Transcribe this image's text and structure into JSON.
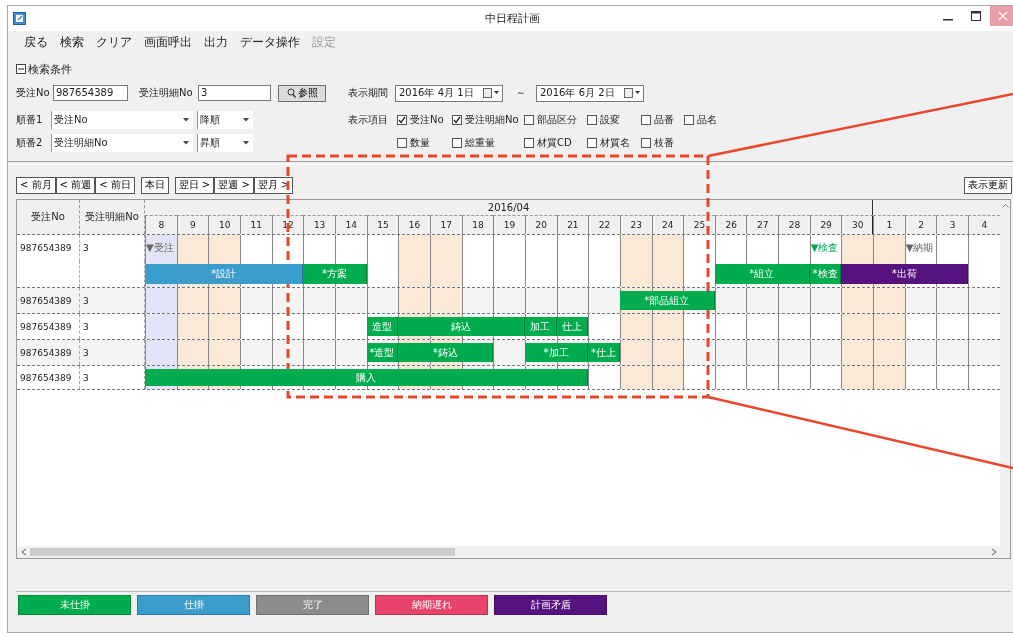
{
  "window": {
    "title": "中日程計画"
  },
  "menu": [
    {
      "label": "戻る",
      "disabled": false
    },
    {
      "label": "検索",
      "disabled": false
    },
    {
      "label": "クリア",
      "disabled": false
    },
    {
      "label": "画面呼出",
      "disabled": false
    },
    {
      "label": "出力",
      "disabled": false
    },
    {
      "label": "データ操作",
      "disabled": false
    },
    {
      "label": "設定",
      "disabled": true
    }
  ],
  "search": {
    "title": "検索条件",
    "expanded": true,
    "order_no": {
      "label": "受注No",
      "value": "987654389"
    },
    "detail_no": {
      "label": "受注明細No",
      "value": "3"
    },
    "lookup_button": "参照",
    "period": {
      "label": "表示期間",
      "from": "2016年 4月 1日",
      "separator": "～",
      "to": "2016年 6月 2日"
    },
    "sort": [
      {
        "label": "順番1",
        "field": "受注No",
        "order": "降順"
      },
      {
        "label": "順番2",
        "field": "受注明細No",
        "order": "昇順"
      }
    ],
    "display_items_label": "表示項目",
    "display_items": [
      {
        "label": "受注No",
        "checked": true
      },
      {
        "label": "受注明細No",
        "checked": true
      },
      {
        "label": "部品区分",
        "checked": false
      },
      {
        "label": "設変",
        "checked": false
      },
      {
        "label": "品番",
        "checked": false
      },
      {
        "label": "品名",
        "checked": false
      },
      {
        "label": "数量",
        "checked": false
      },
      {
        "label": "総重量",
        "checked": false
      },
      {
        "label": "材質CD",
        "checked": false
      },
      {
        "label": "材質名",
        "checked": false
      },
      {
        "label": "枝番",
        "checked": false
      }
    ]
  },
  "nav_buttons": [
    [
      "< 前月",
      "< 前週",
      "< 前日"
    ],
    [
      "本日"
    ],
    [
      "翌日 >",
      "翌週 >",
      "翌月 >"
    ]
  ],
  "refresh_button": "表示更新",
  "gantt": {
    "columns": [
      "受注No",
      "受注明細No"
    ],
    "month": "2016/04",
    "days": [
      {
        "label": "8",
        "kind": "today",
        "month_end": false
      },
      {
        "label": "9",
        "kind": "weekend",
        "month_end": false
      },
      {
        "label": "10",
        "kind": "weekend",
        "month_end": false
      },
      {
        "label": "11",
        "kind": "weekday",
        "month_end": false
      },
      {
        "label": "12",
        "kind": "weekday",
        "month_end": false
      },
      {
        "label": "13",
        "kind": "weekday",
        "month_end": false
      },
      {
        "label": "14",
        "kind": "weekday",
        "month_end": false
      },
      {
        "label": "15",
        "kind": "weekday",
        "month_end": false
      },
      {
        "label": "16",
        "kind": "weekend",
        "month_end": false
      },
      {
        "label": "17",
        "kind": "weekend",
        "month_end": false
      },
      {
        "label": "18",
        "kind": "weekday",
        "month_end": false
      },
      {
        "label": "19",
        "kind": "weekday",
        "month_end": false
      },
      {
        "label": "20",
        "kind": "weekday",
        "month_end": false
      },
      {
        "label": "21",
        "kind": "weekday",
        "month_end": false
      },
      {
        "label": "22",
        "kind": "weekday",
        "month_end": false
      },
      {
        "label": "23",
        "kind": "weekend",
        "month_end": false
      },
      {
        "label": "24",
        "kind": "weekend",
        "month_end": false
      },
      {
        "label": "25",
        "kind": "weekday",
        "month_end": false
      },
      {
        "label": "26",
        "kind": "weekday",
        "month_end": false
      },
      {
        "label": "27",
        "kind": "weekday",
        "month_end": false
      },
      {
        "label": "28",
        "kind": "weekday",
        "month_end": false
      },
      {
        "label": "29",
        "kind": "weekday",
        "month_end": false
      },
      {
        "label": "30",
        "kind": "weekend",
        "month_end": true
      },
      {
        "label": "1",
        "kind": "weekend",
        "month_end": false
      },
      {
        "label": "2",
        "kind": "weekday",
        "month_end": false
      },
      {
        "label": "3",
        "kind": "weekday",
        "month_end": false
      },
      {
        "label": "4",
        "kind": "weekday",
        "month_end": false
      }
    ],
    "rows": [
      {
        "order_no": "987654389",
        "detail_no": "3",
        "lanes": [
          [
            {
              "kind": "milestone",
              "label": "▼受注",
              "color": "#666666"
            },
            {
              "kind": "empty"
            },
            {
              "kind": "empty"
            },
            {
              "kind": "empty"
            },
            {
              "kind": "empty"
            },
            {
              "kind": "empty"
            },
            {
              "kind": "empty"
            },
            {
              "kind": "empty"
            },
            {
              "kind": "empty"
            },
            {
              "kind": "empty"
            },
            {
              "kind": "empty"
            },
            {
              "kind": "empty"
            },
            {
              "kind": "empty"
            },
            {
              "kind": "empty"
            },
            {
              "kind": "empty"
            },
            {
              "kind": "empty"
            },
            {
              "kind": "empty"
            },
            {
              "kind": "empty"
            },
            {
              "kind": "empty"
            },
            {
              "kind": "empty"
            },
            {
              "kind": "empty"
            },
            {
              "kind": "milestone",
              "label": "▼検査",
              "color": "#00a651"
            },
            {
              "kind": "empty"
            },
            {
              "kind": "empty"
            },
            {
              "kind": "milestone",
              "label": "▼納期",
              "color": "#666666"
            }
          ],
          [
            {
              "kind": "bar",
              "label": "*設計",
              "color": "#3b9dcb"
            },
            {
              "kind": "more"
            },
            {
              "kind": "more"
            },
            {
              "kind": "more"
            },
            {
              "kind": "more"
            },
            {
              "kind": "bar",
              "label": "*方案",
              "color": "#00ac4e"
            },
            {
              "kind": "more"
            },
            {
              "kind": "empty"
            },
            {
              "kind": "empty"
            },
            {
              "kind": "empty"
            },
            {
              "kind": "empty"
            },
            {
              "kind": "empty"
            },
            {
              "kind": "empty"
            },
            {
              "kind": "empty"
            },
            {
              "kind": "empty"
            },
            {
              "kind": "empty"
            },
            {
              "kind": "empty"
            },
            {
              "kind": "empty"
            },
            {
              "kind": "bar",
              "label": "*組立",
              "color": "#00ac4e"
            },
            {
              "kind": "more"
            },
            {
              "kind": "more"
            },
            {
              "kind": "bar",
              "label": "*検査",
              "color": "#00ac4e"
            },
            {
              "kind": "bar",
              "label": "*出荷",
              "color": "#56137f"
            },
            {
              "kind": "more"
            },
            {
              "kind": "more"
            },
            {
              "kind": "more"
            }
          ]
        ]
      },
      {
        "order_no": "987654389",
        "detail_no": "3",
        "lanes": [
          [
            {
              "kind": "empty"
            },
            {
              "kind": "empty"
            },
            {
              "kind": "empty"
            },
            {
              "kind": "empty"
            },
            {
              "kind": "empty"
            },
            {
              "kind": "empty"
            },
            {
              "kind": "empty"
            },
            {
              "kind": "empty"
            },
            {
              "kind": "empty"
            },
            {
              "kind": "empty"
            },
            {
              "kind": "empty"
            },
            {
              "kind": "empty"
            },
            {
              "kind": "empty"
            },
            {
              "kind": "empty"
            },
            {
              "kind": "empty"
            },
            {
              "kind": "bar",
              "label": "*部品組立",
              "color": "#00ac4e"
            },
            {
              "kind": "more"
            },
            {
              "kind": "more"
            }
          ]
        ]
      },
      {
        "order_no": "987654389",
        "detail_no": "3",
        "lanes": [
          [
            {
              "kind": "empty"
            },
            {
              "kind": "empty"
            },
            {
              "kind": "empty"
            },
            {
              "kind": "empty"
            },
            {
              "kind": "empty"
            },
            {
              "kind": "empty"
            },
            {
              "kind": "empty"
            },
            {
              "kind": "bar",
              "label": "造型",
              "color": "#00ac4e"
            },
            {
              "kind": "bar",
              "label": "鋳込",
              "color": "#00ac4e"
            },
            {
              "kind": "more"
            },
            {
              "kind": "more"
            },
            {
              "kind": "more"
            },
            {
              "kind": "bar",
              "label": "加工",
              "color": "#00ac4e"
            },
            {
              "kind": "bar",
              "label": "仕上",
              "color": "#00ac4e"
            }
          ]
        ]
      },
      {
        "order_no": "987654389",
        "detail_no": "3",
        "lanes": [
          [
            {
              "kind": "empty"
            },
            {
              "kind": "empty"
            },
            {
              "kind": "empty"
            },
            {
              "kind": "empty"
            },
            {
              "kind": "empty"
            },
            {
              "kind": "empty"
            },
            {
              "kind": "empty"
            },
            {
              "kind": "bar",
              "label": "*造型",
              "color": "#00ac4e"
            },
            {
              "kind": "bar",
              "label": "*鋳込",
              "color": "#00ac4e"
            },
            {
              "kind": "more"
            },
            {
              "kind": "more"
            },
            {
              "kind": "empty"
            },
            {
              "kind": "bar",
              "label": "*加工",
              "color": "#00ac4e"
            },
            {
              "kind": "more"
            },
            {
              "kind": "bar",
              "label": "*仕上",
              "color": "#00ac4e"
            }
          ]
        ]
      },
      {
        "order_no": "987654389",
        "detail_no": "3",
        "lanes": [
          [
            {
              "kind": "bar",
              "label": "購入",
              "color": "#00ac4e"
            },
            {
              "kind": "more"
            },
            {
              "kind": "more"
            },
            {
              "kind": "more"
            },
            {
              "kind": "more"
            },
            {
              "kind": "more"
            },
            {
              "kind": "more"
            },
            {
              "kind": "more"
            },
            {
              "kind": "more"
            },
            {
              "kind": "more"
            },
            {
              "kind": "more"
            },
            {
              "kind": "more"
            },
            {
              "kind": "more"
            },
            {
              "kind": "more"
            }
          ]
        ]
      }
    ]
  },
  "legend": [
    {
      "label": "未仕掛",
      "color": "#00ac4e"
    },
    {
      "label": "仕掛",
      "color": "#3b9dcb"
    },
    {
      "label": "完了",
      "color": "#8c8c8c"
    },
    {
      "label": "納期遅れ",
      "color": "#e8436a"
    },
    {
      "label": "計画矛盾",
      "color": "#56137f"
    }
  ]
}
